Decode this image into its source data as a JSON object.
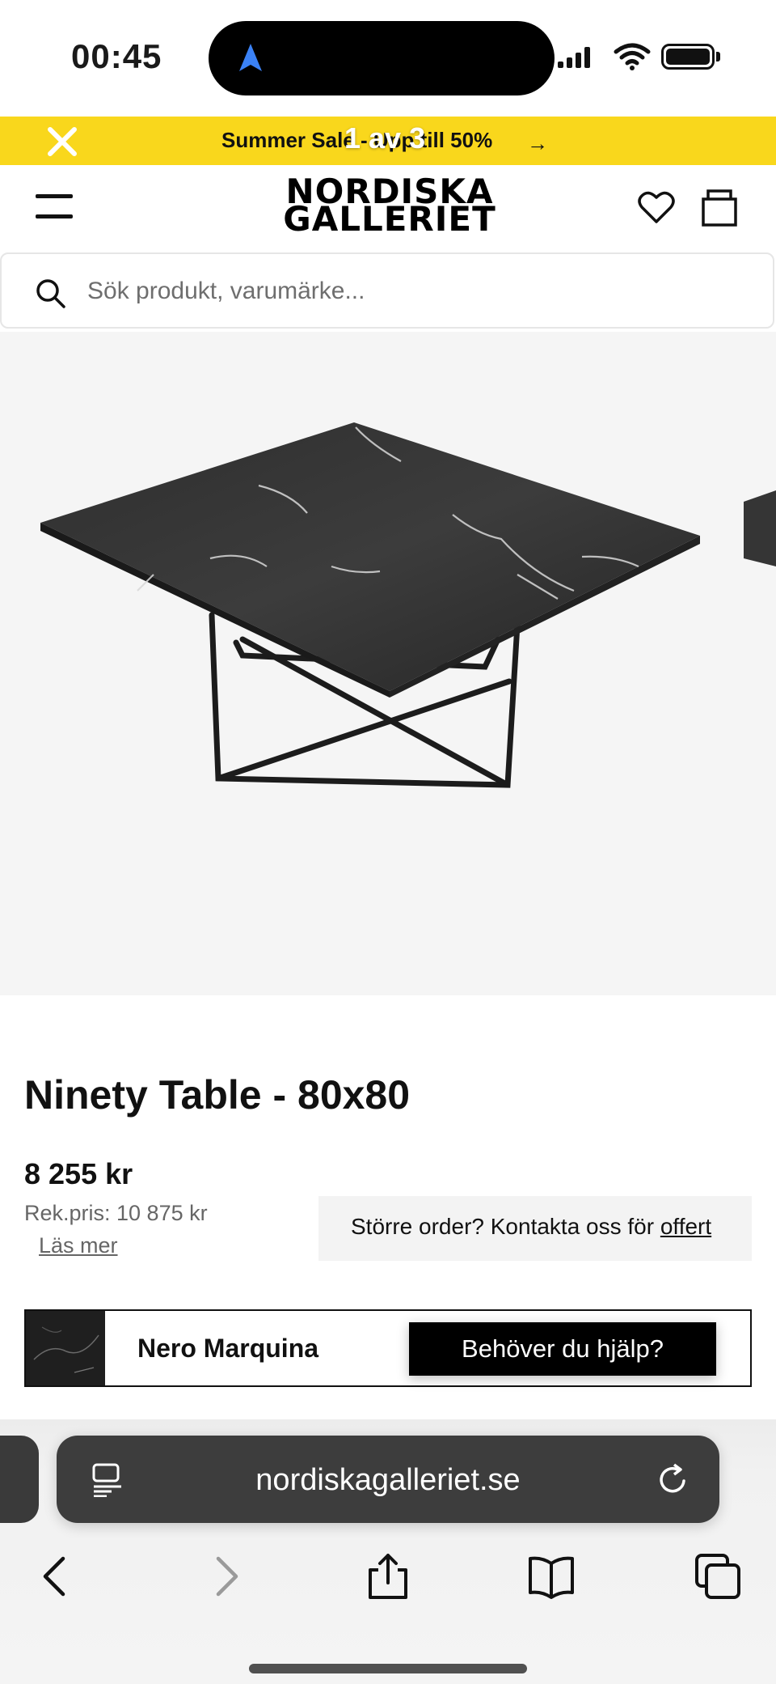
{
  "status_bar": {
    "time": "00:45"
  },
  "promo": {
    "text": "Summer Sale - Upp till 50%",
    "arrow": "→",
    "counter": "1 av 3",
    "close_icon": "close-icon",
    "color": "#f9d71c"
  },
  "header": {
    "logo_line1": "NORDISKA",
    "logo_line2": "GALLERIET",
    "menu_icon": "hamburger-icon",
    "wishlist_icon": "heart-icon",
    "cart_icon": "bag-icon"
  },
  "search": {
    "placeholder": "Sök produkt, varumärke..."
  },
  "product": {
    "title": "Ninety Table - 80x80",
    "price": "8 255 kr",
    "rek_price": "Rek.pris: 10 875 kr",
    "read_more": "Läs mer",
    "quote_prefix": "Större order? Kontakta oss för ",
    "quote_link": "offert",
    "variant_name": "Nero Marquina",
    "help_button": "Behöver du hjälp?"
  },
  "browser": {
    "url": "nordiskagalleriet.se",
    "icons": [
      "reader-icon",
      "reload-icon",
      "back-icon",
      "forward-icon",
      "share-icon",
      "bookmarks-icon",
      "tabs-icon"
    ]
  }
}
